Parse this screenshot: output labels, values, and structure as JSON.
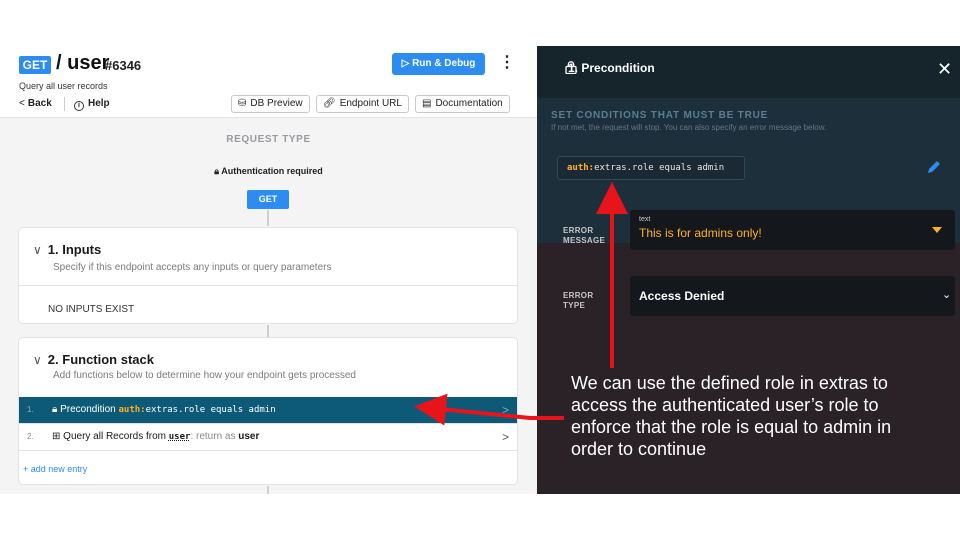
{
  "endpoint": {
    "method": "GET",
    "route": "/ user",
    "id": "#6346",
    "subtitle": "Query all user records"
  },
  "header": {
    "back_label": "Back",
    "help_label": "Help",
    "run_label": "Run & Debug",
    "db_preview_label": "DB Preview",
    "endpoint_url_label": "Endpoint URL",
    "documentation_label": "Documentation"
  },
  "request": {
    "type_label": "REQUEST TYPE",
    "auth_label": "Authentication required",
    "method_button": "GET"
  },
  "inputs": {
    "title": "1. Inputs",
    "description": "Specify if this endpoint accepts any inputs or query parameters",
    "empty_text": "NO INPUTS EXIST"
  },
  "function_stack": {
    "title": "2. Function stack",
    "description": "Add functions below to determine how your endpoint gets processed",
    "items": [
      {
        "num": "1.",
        "name": "Precondition",
        "code_kw": "auth:",
        "code_rest": "extras.role equals admin"
      },
      {
        "num": "2.",
        "name": "Query all Records from",
        "table": "user",
        "suffix": ": return as",
        "var": "user"
      }
    ],
    "add_label": "add new entry"
  },
  "panel": {
    "title": "1. Precondition",
    "heading": "SET CONDITIONS THAT MUST BE TRUE",
    "subheading": "If not met, the request will stop. You can also specify an error message below.",
    "condition_kw": "auth:",
    "condition_rest": "extras.role equals admin",
    "error_message_label_1": "ERROR",
    "error_message_label_2": "MESSAGE",
    "error_message_type": "text",
    "error_message_value": "This is for admins only!",
    "error_type_label_1": "ERROR",
    "error_type_label_2": "TYPE",
    "error_type_value": "Access Denied"
  },
  "annotation": "We can use the defined role in extras to access the authenticated user’s role to enforce that the role is equal to admin in order to continue",
  "colors": {
    "accent_blue": "#2d8cf0",
    "active_row": "#0d5a78",
    "code_keyword": "#ffb020",
    "arrow_red": "#e8141b"
  }
}
